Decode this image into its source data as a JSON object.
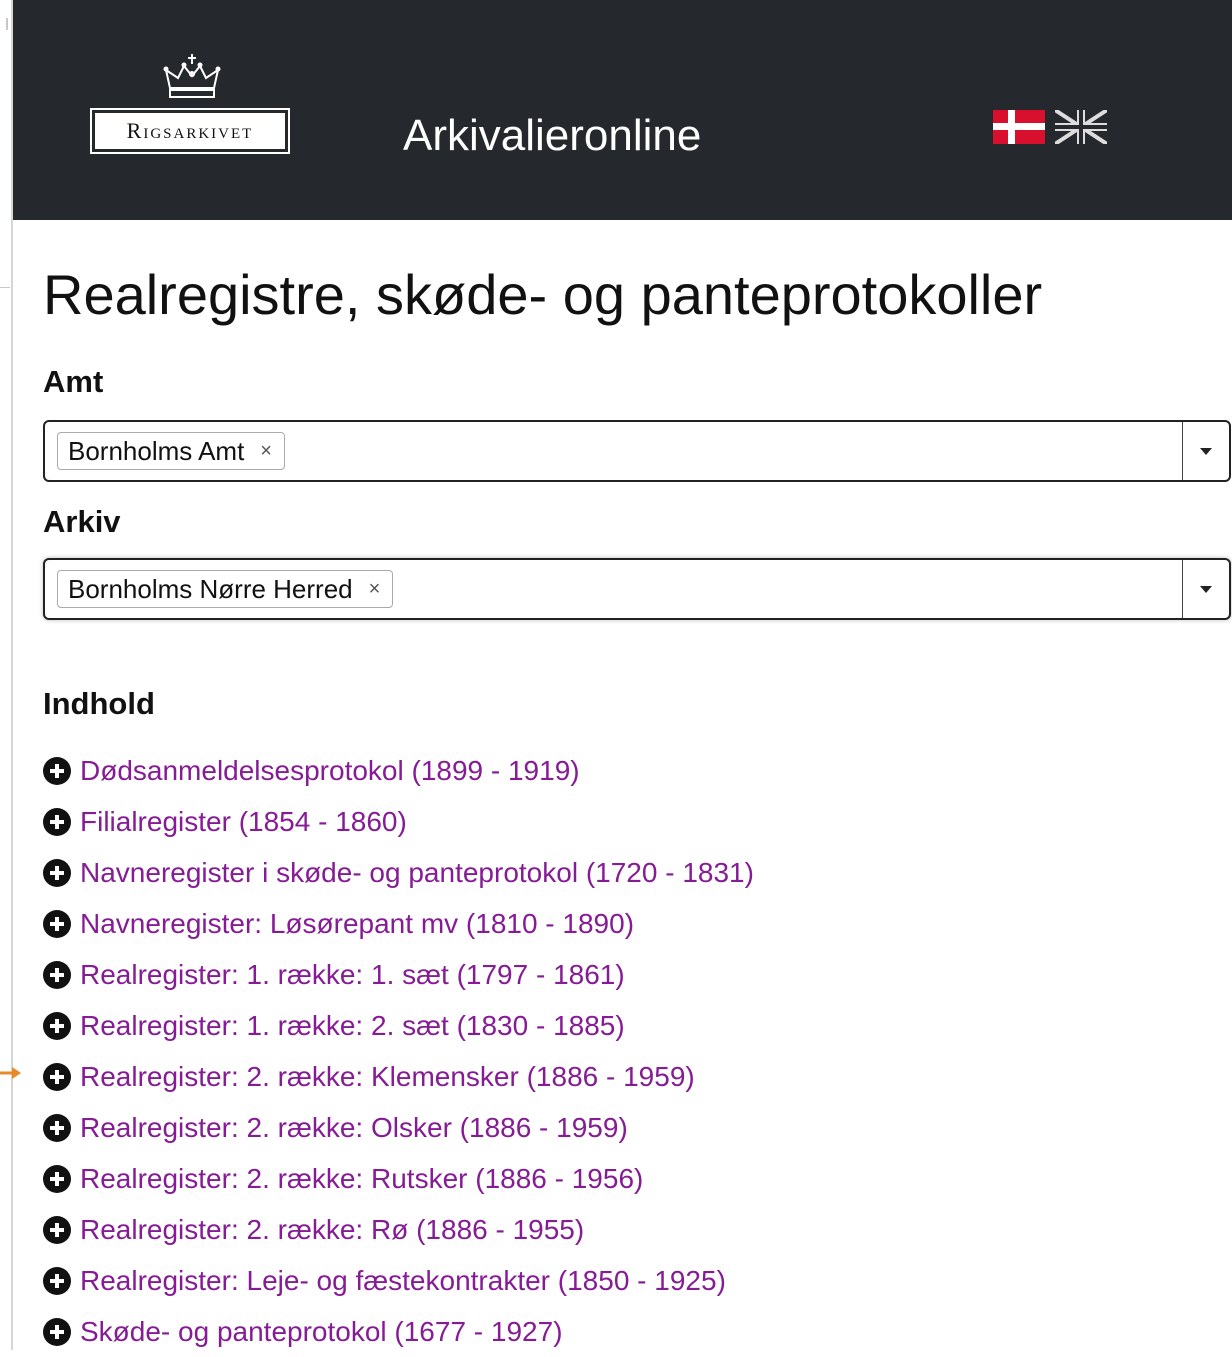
{
  "header": {
    "logo_text": "Rigsarkivet",
    "site_title": "Arkivalieronline",
    "languages": [
      {
        "code": "da",
        "icon": "danish-flag-icon"
      },
      {
        "code": "en",
        "icon": "uk-flag-icon"
      }
    ]
  },
  "page": {
    "title": "Realregistre, skøde- og panteprotokoller"
  },
  "filters": {
    "amt": {
      "label": "Amt",
      "selected": "Bornholms Amt",
      "remove_symbol": "×"
    },
    "arkiv": {
      "label": "Arkiv",
      "selected": "Bornholms Nørre Herred",
      "remove_symbol": "×"
    }
  },
  "content": {
    "heading": "Indhold",
    "items": [
      "Dødsanmeldelsesprotokol (1899 - 1919)",
      "Filialregister (1854 - 1860)",
      "Navneregister i skøde- og panteprotokol (1720 - 1831)",
      "Navneregister: Løsørepant mv (1810 - 1890)",
      "Realregister: 1. række: 1. sæt (1797 - 1861)",
      "Realregister: 1. række: 2. sæt (1830 - 1885)",
      "Realregister: 2. række: Klemensker (1886 - 1959)",
      "Realregister: 2. række: Olsker (1886 - 1959)",
      "Realregister: 2. række: Rutsker (1886 - 1956)",
      "Realregister: 2. række: Rø (1886 - 1955)",
      "Realregister: Leje- og fæstekontrakter (1850 - 1925)",
      "Skøde- og panteprotokol (1677 - 1927)"
    ],
    "link_color": "#861c95"
  },
  "colors": {
    "header_bg": "#25282c",
    "pointer_arrow": "#e8892a"
  }
}
